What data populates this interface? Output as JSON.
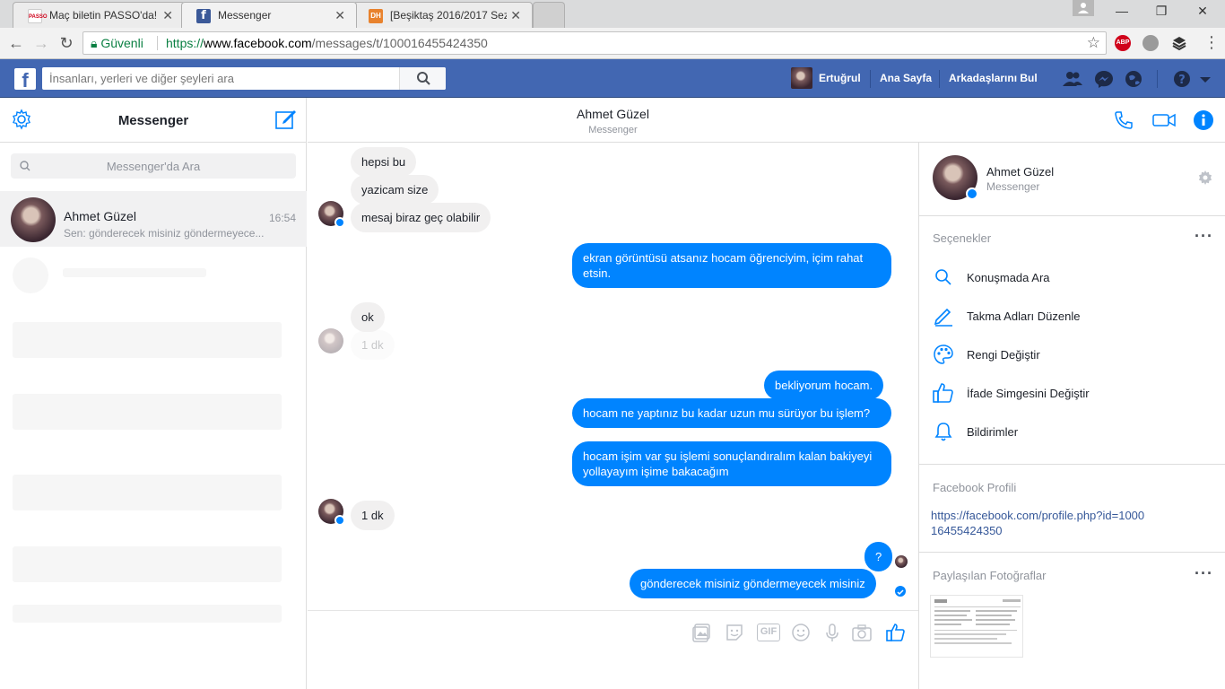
{
  "browser": {
    "tabs": [
      {
        "title": "Maç biletin PASSO'da!",
        "favicon": "PASSO"
      },
      {
        "title": "Messenger",
        "favicon": "f"
      },
      {
        "title": "[Beşiktaş 2016/2017 Sez",
        "favicon": "DH"
      }
    ],
    "secure_label": "Güvenli",
    "url_scheme": "https://",
    "url_host": "www.facebook.com",
    "url_path": "/messages/t/100016455424350",
    "extension_abp": "ABP"
  },
  "fb": {
    "search_placeholder": "İnsanları, yerleri ve diğer şeyleri ara",
    "user_name": "Ertuğrul",
    "home_label": "Ana Sayfa",
    "find_friends_label": "Arkadaşlarını Bul"
  },
  "left": {
    "title": "Messenger",
    "search_placeholder": "Messenger'da Ara",
    "conversation": {
      "name": "Ahmet Güzel",
      "time": "16:54",
      "snippet": "Sen: gönderecek misiniz göndermeyece..."
    }
  },
  "thread": {
    "name": "Ahmet Güzel",
    "subtitle": "Messenger",
    "messages": [
      {
        "dir": "in",
        "text": "hepsi bu"
      },
      {
        "dir": "in",
        "text": "yazicam size"
      },
      {
        "dir": "in",
        "text": "mesaj biraz geç olabilir"
      },
      {
        "dir": "out",
        "text": "ekran görüntüsü atsanız hocam öğrenciyim, içim rahat etsin."
      },
      {
        "dir": "in",
        "text": "ok"
      },
      {
        "dir": "in",
        "text": "1 dk"
      },
      {
        "dir": "out",
        "text": "bekliyorum hocam."
      },
      {
        "dir": "out",
        "text": "hocam ne yaptınız bu kadar uzun mu sürüyor bu işlem?"
      },
      {
        "dir": "out",
        "text": "hocam işim var şu işlemi sonuçlandıralım kalan bakiyeyi yollayayım işime bakacağım"
      },
      {
        "dir": "in",
        "text": "1 dk"
      },
      {
        "dir": "out",
        "text": "?"
      },
      {
        "dir": "out",
        "text": "gönderecek misiniz göndermeyecek misiniz"
      }
    ],
    "composer_icons": [
      "photo-icon",
      "sticker-icon",
      "gif-icon",
      "emoji-icon",
      "microphone-icon",
      "camera-icon",
      "like-icon"
    ],
    "gif_label": "GIF"
  },
  "right": {
    "profile_name": "Ahmet Güzel",
    "profile_sub": "Messenger",
    "options_title": "Seçenekler",
    "options": [
      {
        "label": "Konuşmada Ara",
        "icon": "search-icon"
      },
      {
        "label": "Takma Adları Düzenle",
        "icon": "pencil-icon"
      },
      {
        "label": "Rengi Değiştir",
        "icon": "palette-icon"
      },
      {
        "label": "İfade Simgesini Değiştir",
        "icon": "thumbs-up-icon"
      },
      {
        "label": "Bildirimler",
        "icon": "bell-icon"
      }
    ],
    "fb_profile_title": "Facebook Profili",
    "fb_profile_link": "https://facebook.com/profile.php?id=100016455424350",
    "photos_title": "Paylaşılan Fotoğraflar"
  },
  "colors": {
    "fb_blue": "#4267b2",
    "messenger_blue": "#0084ff",
    "bubble_gray": "#f1f0f0"
  }
}
